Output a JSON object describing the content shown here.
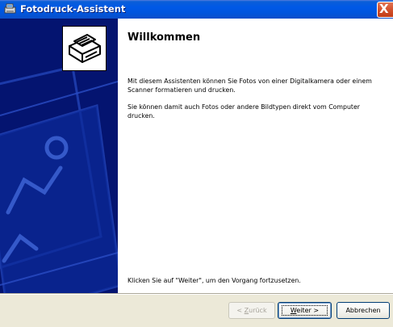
{
  "window": {
    "title": "Fotodruck-Assistent",
    "close_symbol": "X"
  },
  "content": {
    "heading": "Willkommen",
    "paragraph1": "Mit diesem Assistenten können Sie Fotos von einer Digitalkamera oder einem Scanner formatieren und drucken.",
    "paragraph2": "Sie können damit auch Fotos oder andere Bildtypen direkt vom Computer drucken.",
    "footer": "Klicken Sie auf \"Weiter\", um den Vorgang fortzusetzen."
  },
  "buttons": {
    "back_prefix": "< ",
    "back_key": "Z",
    "back_rest": "urück",
    "next_key": "W",
    "next_rest": "eiter >",
    "cancel": "Abbrechen"
  },
  "icons": {
    "app": "photo-printer-icon",
    "wizard": "photo-printer-icon",
    "watermark": "photo-watermark-graphic"
  },
  "colors": {
    "titlebar": "#0058e6",
    "left_panel": "#041470",
    "button_bar": "#ece9d8",
    "close_button": "#d5532f"
  }
}
